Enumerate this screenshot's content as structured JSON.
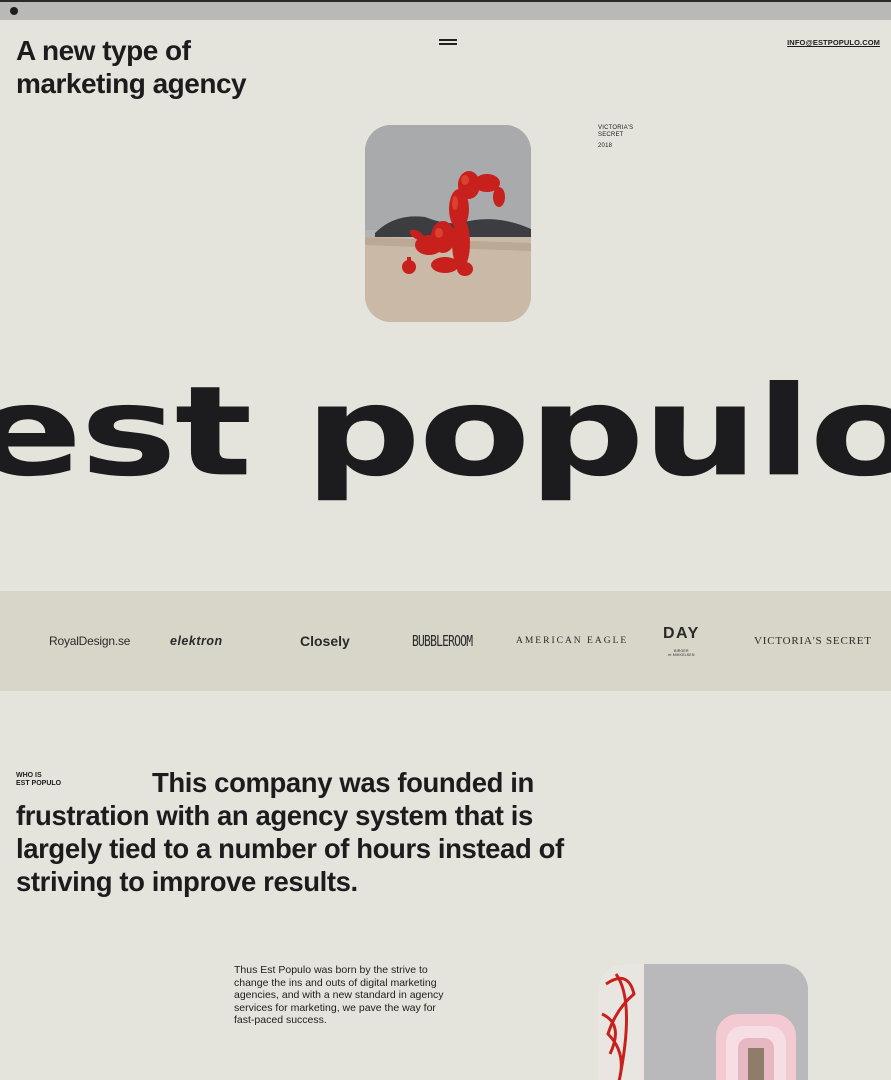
{
  "header": {
    "title": "A new type of\nmarketing agency",
    "email": "INFO@ESTPOPULO.COM",
    "menu_icon": "hamburger-menu-icon"
  },
  "featured": {
    "image_subject": "red balloon dog sculpture",
    "client": "VICTORIA'S\nSECRET",
    "year": "2018"
  },
  "wordmark": "est populo",
  "clients": {
    "logos": [
      "RoyalDesign.se",
      "elektron",
      "Closely",
      "BUBBLEROOM",
      "AMERICAN EAGLE",
      "DAY",
      "VICTORIA'S SECRET"
    ],
    "day_sub": "BIRGER\net MIKKELSEN"
  },
  "about": {
    "label": "WHO IS\nEST POPULO",
    "heading": "This company was founded in frustration with an agency system that is largely tied to a number of hours instead of striving to improve results.",
    "body": "Thus Est Populo was born by the strive to change the ins and outs of digital marketing agencies, and with a new standard in agency services for marketing, we pave the way for fast-paced success."
  },
  "colors": {
    "background": "#e5e4dc",
    "logo_strip": "#d8d5c9",
    "text": "#1c1c1e",
    "accent_red": "#c8201c"
  }
}
